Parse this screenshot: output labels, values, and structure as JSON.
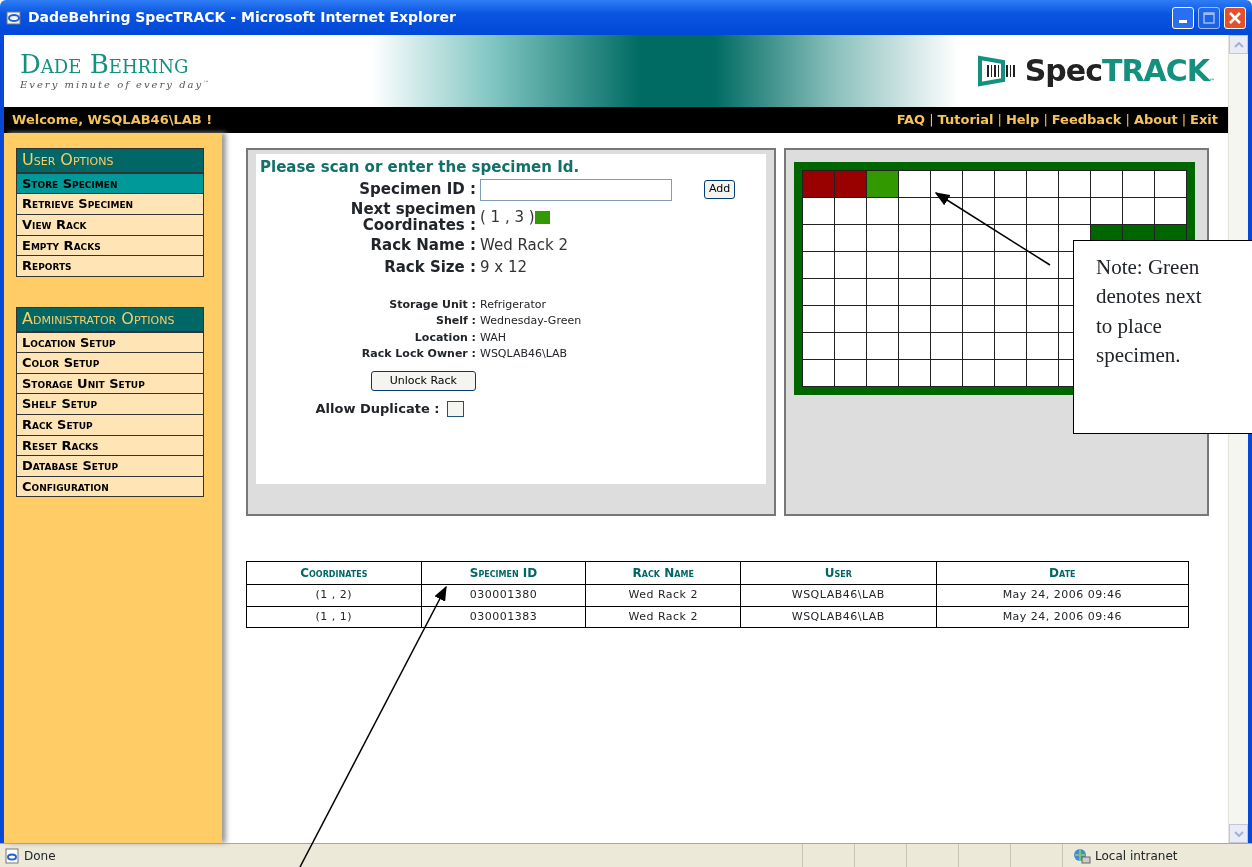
{
  "window": {
    "title": "DadeBehring SpecTRACK - Microsoft Internet Explorer"
  },
  "header": {
    "brand": "Dade Behring",
    "tagline": "Every minute of every day",
    "tagline_mark": "™",
    "product_dark": "Spec",
    "product_accent": "TRACK",
    "product_mark": "™"
  },
  "welcome": "Welcome, WSQLAB46\\LAB !",
  "top_links": [
    {
      "kind": "link",
      "text": "FAQ"
    },
    {
      "kind": "separator",
      "text": "|"
    },
    {
      "kind": "link",
      "text": "Tutorial"
    },
    {
      "kind": "separator",
      "text": "|"
    },
    {
      "kind": "link",
      "text": "Help"
    },
    {
      "kind": "separator",
      "text": "|"
    },
    {
      "kind": "link",
      "text": "Feedback"
    },
    {
      "kind": "separator",
      "text": "|"
    },
    {
      "kind": "link",
      "text": "About"
    },
    {
      "kind": "separator",
      "text": "|"
    },
    {
      "kind": "link",
      "text": "Exit"
    }
  ],
  "sidebar": [
    {
      "title": "User Options",
      "items": [
        {
          "label": "Store Specimen",
          "selected": true
        },
        {
          "label": "Retrieve Specimen",
          "selected": false
        },
        {
          "label": "View Rack",
          "selected": false
        },
        {
          "label": "Empty Racks",
          "selected": false
        },
        {
          "label": "Reports",
          "selected": false
        }
      ]
    },
    {
      "title": "Administrator Options",
      "items": [
        {
          "label": "Location Setup",
          "selected": false
        },
        {
          "label": "Color Setup",
          "selected": false
        },
        {
          "label": "Storage Unit Setup",
          "selected": false
        },
        {
          "label": "Shelf Setup",
          "selected": false
        },
        {
          "label": "Rack Setup",
          "selected": false
        },
        {
          "label": "Reset Racks",
          "selected": false
        },
        {
          "label": "Database Setup",
          "selected": false
        },
        {
          "label": "Configuration",
          "selected": false
        }
      ]
    }
  ],
  "form": {
    "prompt": "Please scan or enter the specimen Id.",
    "specimen_id_label": "Specimen ID :",
    "add_button": "Add",
    "main_fields": [
      {
        "label": "Next specimen Coordinates :",
        "value": "( 1 , 3 )",
        "color": "#339900"
      },
      {
        "label": "Rack Name :",
        "value": "Wed Rack 2"
      },
      {
        "label": "Rack Size :",
        "value": "9 x 12"
      }
    ],
    "details": [
      {
        "label": "Storage Unit :",
        "value": "Refrigerator"
      },
      {
        "label": "Shelf :",
        "value": "Wednesday-Green"
      },
      {
        "label": "Location :",
        "value": "WAH"
      },
      {
        "label": "Rack Lock Owner :",
        "value": "WSQLAB46\\LAB"
      }
    ],
    "unlock_button": "Unlock Rack",
    "allow_duplicate": {
      "label": "Allow Duplicate :",
      "checked": false
    }
  },
  "rack": [
    {
      "cells": [
        {
          "color": "#990000"
        },
        {
          "color": "#990000"
        },
        {
          "color": "#339900"
        },
        {
          "color": "#ffffff"
        },
        {
          "color": "#ffffff"
        },
        {
          "color": "#ffffff"
        },
        {
          "color": "#ffffff"
        },
        {
          "color": "#ffffff"
        },
        {
          "color": "#ffffff"
        },
        {
          "color": "#ffffff"
        },
        {
          "color": "#ffffff"
        },
        {
          "color": "#ffffff"
        }
      ]
    },
    {
      "cells": [
        {
          "color": "#ffffff"
        },
        {
          "color": "#ffffff"
        },
        {
          "color": "#ffffff"
        },
        {
          "color": "#ffffff"
        },
        {
          "color": "#ffffff"
        },
        {
          "color": "#ffffff"
        },
        {
          "color": "#ffffff"
        },
        {
          "color": "#ffffff"
        },
        {
          "color": "#ffffff"
        },
        {
          "color": "#ffffff"
        },
        {
          "color": "#ffffff"
        },
        {
          "color": "#ffffff"
        }
      ]
    },
    {
      "cells": [
        {
          "color": "#ffffff"
        },
        {
          "color": "#ffffff"
        },
        {
          "color": "#ffffff"
        },
        {
          "color": "#ffffff"
        },
        {
          "color": "#ffffff"
        },
        {
          "color": "#ffffff"
        },
        {
          "color": "#ffffff"
        },
        {
          "color": "#ffffff"
        },
        {
          "color": "#ffffff"
        },
        null,
        null,
        null
      ]
    },
    {
      "cells": [
        {
          "color": "#ffffff"
        },
        {
          "color": "#ffffff"
        },
        {
          "color": "#ffffff"
        },
        {
          "color": "#ffffff"
        },
        {
          "color": "#ffffff"
        },
        {
          "color": "#ffffff"
        },
        {
          "color": "#ffffff"
        },
        {
          "color": "#ffffff"
        },
        {
          "color": "#ffffff"
        },
        null,
        null,
        null
      ]
    },
    {
      "cells": [
        {
          "color": "#ffffff"
        },
        {
          "color": "#ffffff"
        },
        {
          "color": "#ffffff"
        },
        {
          "color": "#ffffff"
        },
        {
          "color": "#ffffff"
        },
        {
          "color": "#ffffff"
        },
        {
          "color": "#ffffff"
        },
        {
          "color": "#ffffff"
        },
        {
          "color": "#ffffff"
        },
        null,
        null,
        null
      ]
    },
    {
      "cells": [
        {
          "color": "#ffffff"
        },
        {
          "color": "#ffffff"
        },
        {
          "color": "#ffffff"
        },
        {
          "color": "#ffffff"
        },
        {
          "color": "#ffffff"
        },
        {
          "color": "#ffffff"
        },
        {
          "color": "#ffffff"
        },
        {
          "color": "#ffffff"
        },
        {
          "color": "#ffffff"
        },
        null,
        null,
        null
      ]
    },
    {
      "cells": [
        {
          "color": "#ffffff"
        },
        {
          "color": "#ffffff"
        },
        {
          "color": "#ffffff"
        },
        {
          "color": "#ffffff"
        },
        {
          "color": "#ffffff"
        },
        {
          "color": "#ffffff"
        },
        {
          "color": "#ffffff"
        },
        {
          "color": "#ffffff"
        },
        {
          "color": "#ffffff"
        },
        null,
        null,
        null
      ]
    },
    {
      "cells": [
        {
          "color": "#ffffff"
        },
        {
          "color": "#ffffff"
        },
        {
          "color": "#ffffff"
        },
        {
          "color": "#ffffff"
        },
        {
          "color": "#ffffff"
        },
        {
          "color": "#ffffff"
        },
        {
          "color": "#ffffff"
        },
        {
          "color": "#ffffff"
        },
        {
          "color": "#ffffff"
        },
        null,
        null,
        null
      ]
    }
  ],
  "table": {
    "columns": [
      "Coordinates",
      "Specimen ID",
      "Rack Name",
      "User",
      "Date"
    ],
    "rows": [
      [
        "(1 , 2)",
        "030001380",
        "Wed Rack 2",
        "WSQLAB46\\LAB",
        "May 24, 2006 09:46"
      ],
      [
        "(1 , 1)",
        "030001383",
        "Wed Rack 2",
        "WSQLAB46\\LAB",
        "May 24, 2006 09:46"
      ]
    ]
  },
  "status_bar": {
    "text": "Done",
    "zone": "Local intranet"
  },
  "note": {
    "lines": [
      "Note: Green",
      "denotes next",
      "to place",
      "specimen."
    ]
  }
}
